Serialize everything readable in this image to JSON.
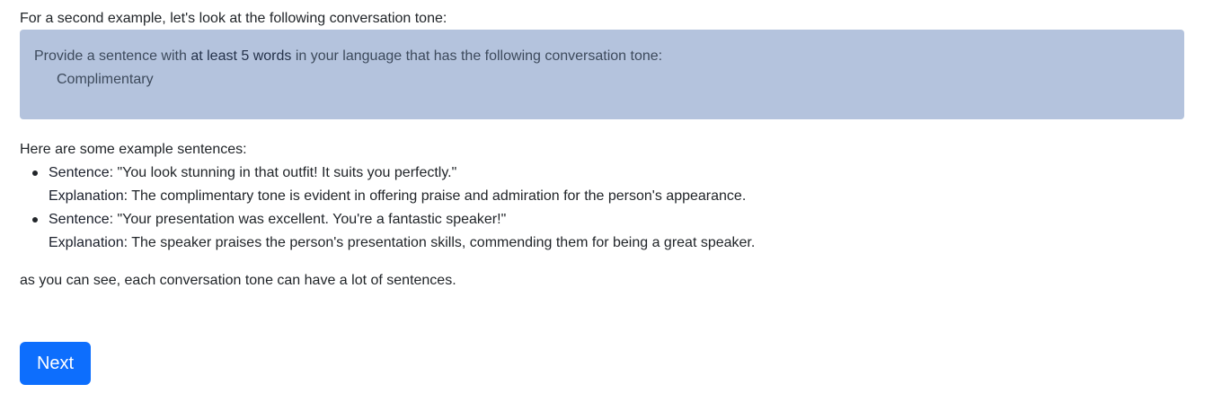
{
  "intro": "For a second example, let's look at the following conversation tone:",
  "task": {
    "prefix": "Provide a sentence with ",
    "emphasis": "at least 5 words",
    "suffix": " in your language that has the following conversation tone:",
    "tone": "Complimentary"
  },
  "examples_heading": "Here are some example sentences:",
  "examples": [
    {
      "sentence_label": "Sentence",
      "sentence": ": \"You look stunning in that outfit! It suits you perfectly.\"",
      "explanation_label": "Explanation",
      "explanation": ": The complimentary tone is evident in offering praise and admiration for the person's appearance."
    },
    {
      "sentence_label": "Sentence",
      "sentence": ": \"Your presentation was excellent. You're a fantastic speaker!\"",
      "explanation_label": "Explanation",
      "explanation": ": The speaker praises the person's presentation skills, commending them for being a great speaker."
    }
  ],
  "outro": "as you can see, each conversation tone can have a lot of sentences.",
  "next_button": {
    "label": "Next",
    "color": "#0d6efd"
  },
  "colors": {
    "task_box_background": "#b4c3dd"
  }
}
